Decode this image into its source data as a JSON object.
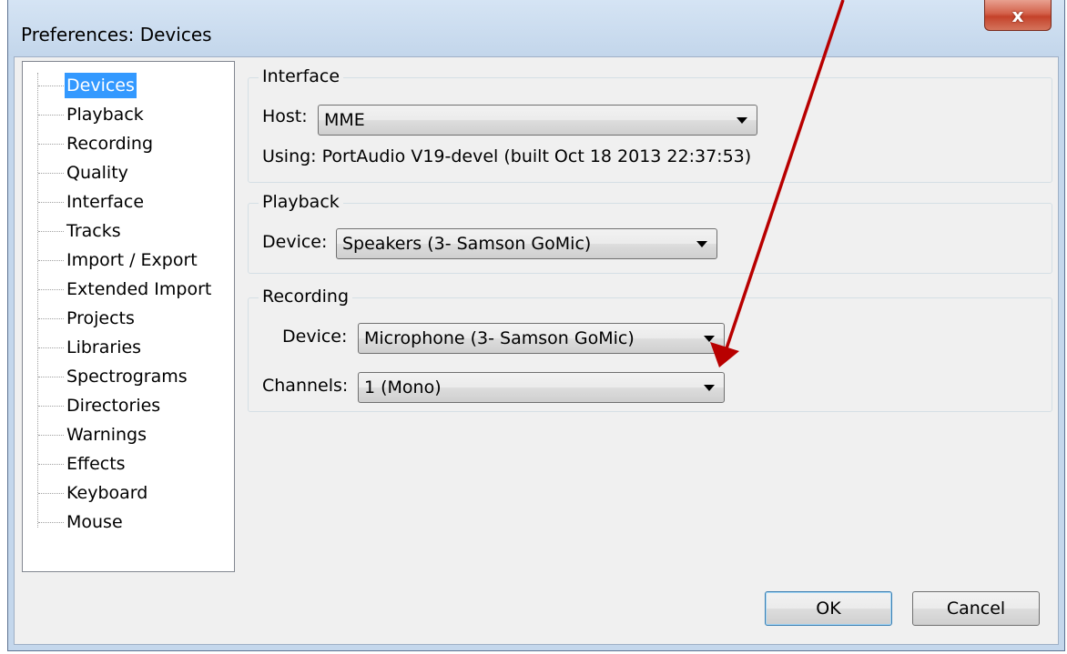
{
  "window": {
    "title": "Preferences: Devices",
    "close_label": "x"
  },
  "sidebar": {
    "selected": "Devices",
    "items": [
      {
        "label": "Devices"
      },
      {
        "label": "Playback"
      },
      {
        "label": "Recording"
      },
      {
        "label": "Quality"
      },
      {
        "label": "Interface"
      },
      {
        "label": "Tracks"
      },
      {
        "label": "Import / Export"
      },
      {
        "label": "Extended Import"
      },
      {
        "label": "Projects"
      },
      {
        "label": "Libraries"
      },
      {
        "label": "Spectrograms"
      },
      {
        "label": "Directories"
      },
      {
        "label": "Warnings"
      },
      {
        "label": "Effects"
      },
      {
        "label": "Keyboard"
      },
      {
        "label": "Mouse"
      }
    ]
  },
  "interface": {
    "group_label": "Interface",
    "host_label": "Host:",
    "host_value": "MME",
    "using_text": "Using: PortAudio V19-devel (built Oct 18 2013 22:37:53)"
  },
  "playback": {
    "group_label": "Playback",
    "device_label": "Device:",
    "device_value": "Speakers (3- Samson GoMic)"
  },
  "recording": {
    "group_label": "Recording",
    "device_label": "Device:",
    "device_value": "Microphone (3- Samson GoMic)",
    "channels_label": "Channels:",
    "channels_value": "1 (Mono)"
  },
  "buttons": {
    "ok": "OK",
    "cancel": "Cancel"
  },
  "colors": {
    "selection": "#3399ff",
    "annotation_arrow": "#b80000",
    "close_button": "#c4422a"
  }
}
